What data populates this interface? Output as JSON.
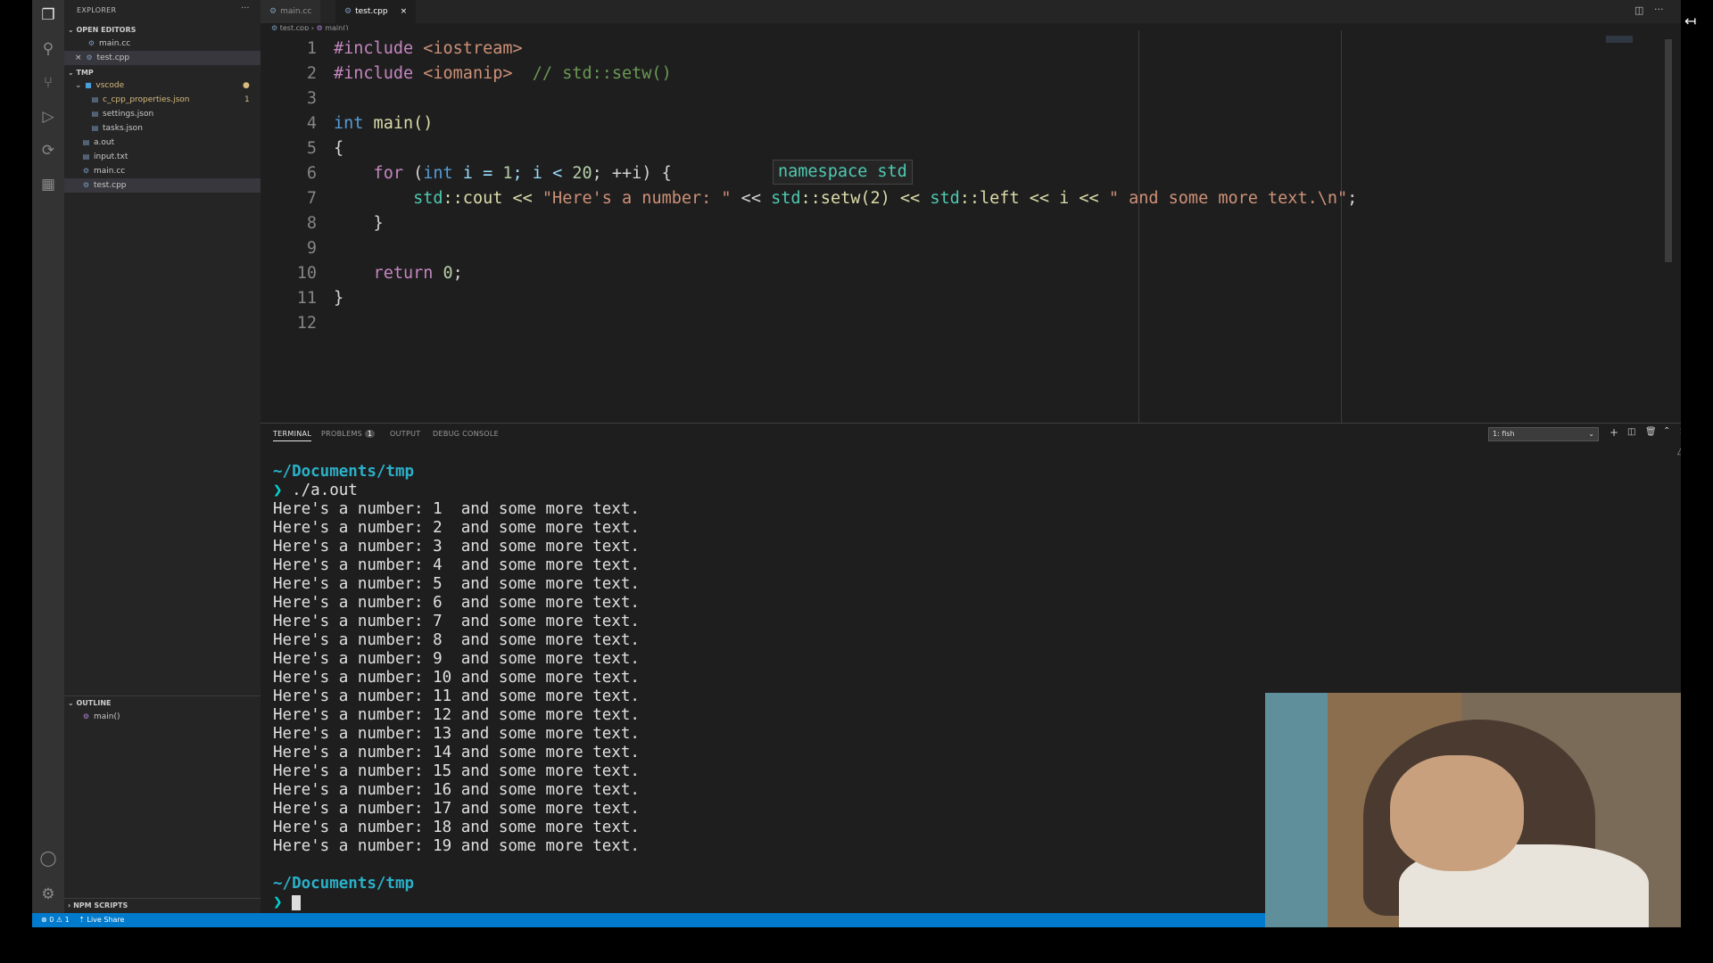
{
  "sidebar": {
    "title": "EXPLORER",
    "open_editors_label": "OPEN EDITORS",
    "open_editors": [
      "main.cc",
      "test.cpp"
    ],
    "folder_label": "TMP",
    "vscode_folder": "vscode",
    "vscode_files": [
      "c_cpp_properties.json",
      "settings.json",
      "tasks.json"
    ],
    "problem_count": "1",
    "files": [
      "a.out",
      "input.txt",
      "main.cc",
      "test.cpp"
    ],
    "outline_label": "OUTLINE",
    "outline_item": "main()",
    "npm_label": "NPM SCRIPTS"
  },
  "tabs": [
    "main.cc",
    "test.cpp"
  ],
  "breadcrumb": {
    "file": "test.cpp",
    "symbol": "main()"
  },
  "editor": {
    "line_numbers": [
      "1",
      "2",
      "3",
      "4",
      "5",
      "6",
      "7",
      "8",
      "9",
      "10",
      "11",
      "12"
    ],
    "code": {
      "l1_pre": "#include ",
      "l1_hdr": "<iostream>",
      "l2_pre": "#include ",
      "l2_hdr": "<iomanip>",
      "l2_cmt": "  // std::setw()",
      "l4_type": "int",
      "l4_fn": " main()",
      "l5": "{",
      "l6_for": "    for",
      "l6_a": " (",
      "l6_int": "int",
      "l6_b": " i = ",
      "l6_n1": "1",
      "l6_c": "; i < ",
      "l6_n2": "20",
      "l6_d": "; ++i) {",
      "l7_ns": "        std",
      "l7_a": "::cout << ",
      "l7_s1": "\"Here's a number: \"",
      "l7_b": " << ",
      "l7_ns2": "std",
      "l7_c": "::setw(2) << ",
      "l7_ns3": "std",
      "l7_d": "::left << i << ",
      "l7_s2": "\" and some more text.\\n\"",
      "l7_e": ";",
      "l8": "    }",
      "l10_ret": "    return",
      "l10_a": " ",
      "l10_n": "0",
      "l10_b": ";",
      "l11": "}"
    },
    "hover_text": "namespace std"
  },
  "panel": {
    "tabs": [
      "TERMINAL",
      "PROBLEMS",
      "OUTPUT",
      "DEBUG CONSOLE"
    ],
    "problems_badge": "1",
    "terminal_select": "1: fish",
    "terminal": {
      "path": "~/Documents/tmp",
      "prompt": "❯",
      "command": " ./a.out",
      "output": [
        "Here's a number: 1  and some more text.",
        "Here's a number: 2  and some more text.",
        "Here's a number: 3  and some more text.",
        "Here's a number: 4  and some more text.",
        "Here's a number: 5  and some more text.",
        "Here's a number: 6  and some more text.",
        "Here's a number: 7  and some more text.",
        "Here's a number: 8  and some more text.",
        "Here's a number: 9  and some more text.",
        "Here's a number: 10 and some more text.",
        "Here's a number: 11 and some more text.",
        "Here's a number: 12 and some more text.",
        "Here's a number: 13 and some more text.",
        "Here's a number: 14 and some more text.",
        "Here's a number: 15 and some more text.",
        "Here's a number: 16 and some more text.",
        "Here's a number: 17 and some more text.",
        "Here's a number: 18 and some more text.",
        "Here's a number: 19 and some more text."
      ]
    }
  },
  "status": {
    "problems": "⊗ 0 ⚠ 1",
    "live_share": "Live Share"
  },
  "colors": {
    "accent": "#007acc",
    "terminal_path": "#2bb0c8"
  }
}
